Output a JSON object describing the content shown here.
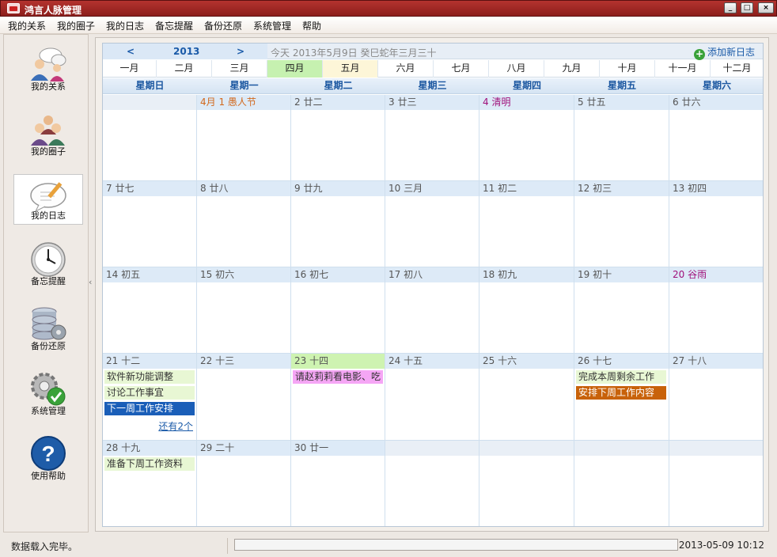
{
  "window": {
    "title": "鸿言人脉管理"
  },
  "menu": [
    "我的关系",
    "我的圈子",
    "我的日志",
    "备忘提醒",
    "备份还原",
    "系统管理",
    "帮助"
  ],
  "sidebar": {
    "items": [
      {
        "label": "我的关系",
        "icon": "contacts-icon"
      },
      {
        "label": "我的圈子",
        "icon": "group-icon"
      },
      {
        "label": "我的日志",
        "icon": "diary-icon",
        "selected": true
      },
      {
        "label": "备忘提醒",
        "icon": "clock-icon"
      },
      {
        "label": "备份还原",
        "icon": "database-icon"
      },
      {
        "label": "系统管理",
        "icon": "settings-icon"
      },
      {
        "label": "使用帮助",
        "icon": "help-icon"
      }
    ],
    "collapse_glyph": "‹"
  },
  "calendar": {
    "prev": "<",
    "year": "2013",
    "next": ">",
    "today": "今天 2013年5月9日 癸巳蛇年三月三十",
    "add_label": "添加新日志",
    "months": [
      "一月",
      "二月",
      "三月",
      "四月",
      "五月",
      "六月",
      "七月",
      "八月",
      "九月",
      "十月",
      "十一月",
      "十二月"
    ],
    "selected_month": "四月",
    "current_month": "五月",
    "weekdays": [
      "星期日",
      "星期一",
      "星期二",
      "星期三",
      "星期四",
      "星期五",
      "星期六"
    ],
    "weeks": [
      [
        {
          "label": "",
          "empty_header": true
        },
        {
          "label": "4月 1 愚人节",
          "color": "#d2691e"
        },
        {
          "label": "2 廿二"
        },
        {
          "label": "3 廿三"
        },
        {
          "label": "4 清明",
          "color": "#a0107a"
        },
        {
          "label": "5 廿五"
        },
        {
          "label": "6 廿六"
        }
      ],
      [
        {
          "label": "7 廿七"
        },
        {
          "label": "8 廿八"
        },
        {
          "label": "9 廿九"
        },
        {
          "label": "10 三月"
        },
        {
          "label": "11 初二"
        },
        {
          "label": "12 初三"
        },
        {
          "label": "13 初四"
        }
      ],
      [
        {
          "label": "14 初五"
        },
        {
          "label": "15 初六"
        },
        {
          "label": "16 初七"
        },
        {
          "label": "17 初八"
        },
        {
          "label": "18 初九"
        },
        {
          "label": "19 初十"
        },
        {
          "label": "20 谷雨",
          "color": "#a0107a"
        }
      ],
      [
        {
          "label": "21 十二",
          "events": [
            {
              "text": "软件新功能调整",
              "bg": "#e8f7d4",
              "fg": "#333"
            },
            {
              "text": "讨论工作事宜",
              "bg": "#e8f7d4",
              "fg": "#333"
            },
            {
              "text": "下一周工作安排",
              "bg": "#1a5eb8",
              "fg": "#ffffff"
            }
          ],
          "more": "还有2个"
        },
        {
          "label": "22 十三"
        },
        {
          "label": "23 十四",
          "highlight": true,
          "events": [
            {
              "text": "请赵莉莉看电影、吃",
              "bg": "#f5a6f5",
              "fg": "#333"
            }
          ]
        },
        {
          "label": "24 十五"
        },
        {
          "label": "25 十六"
        },
        {
          "label": "26 十七",
          "events": [
            {
              "text": "完成本周剩余工作",
              "bg": "#e8f7d4",
              "fg": "#333"
            },
            {
              "text": "安排下周工作内容",
              "bg": "#c8620a",
              "fg": "#ffffff"
            }
          ]
        },
        {
          "label": "27 十八"
        }
      ],
      [
        {
          "label": "28 十九",
          "events": [
            {
              "text": "准备下周工作资料",
              "bg": "#e8f7d4",
              "fg": "#333"
            }
          ]
        },
        {
          "label": "29 二十"
        },
        {
          "label": "30 廿一"
        },
        {
          "label": "",
          "empty_header": true
        },
        {
          "label": "",
          "empty_header": true
        },
        {
          "label": "",
          "empty_header": true
        },
        {
          "label": "",
          "empty_header": true
        }
      ]
    ]
  },
  "status": {
    "text": "数据载入完毕。",
    "datetime": "2013-05-09 10:12"
  }
}
